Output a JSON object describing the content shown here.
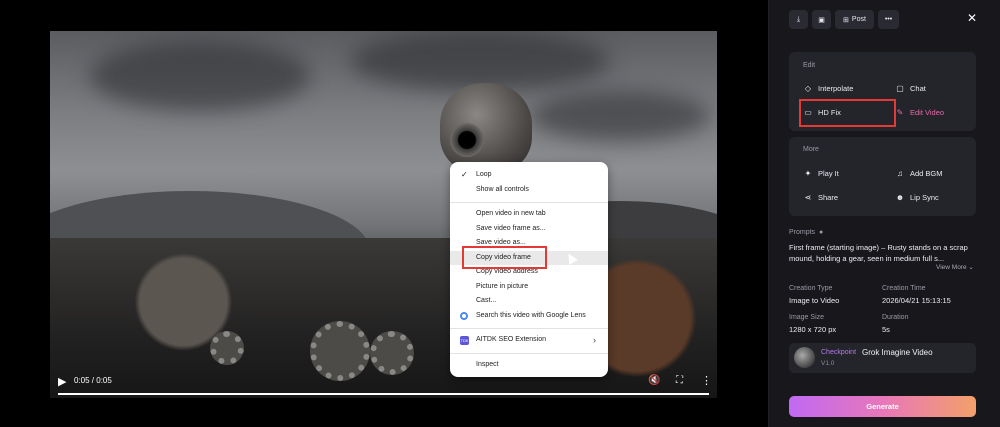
{
  "video": {
    "time": "0:05 / 0:05",
    "progress": 1.0
  },
  "context_menu": {
    "items": [
      {
        "label": "Loop",
        "checked": true
      },
      {
        "label": "Show all controls"
      },
      {
        "label": "Open video in new tab"
      },
      {
        "label": "Save video frame as..."
      },
      {
        "label": "Save video as..."
      },
      {
        "label": "Copy video frame"
      },
      {
        "label": "Copy video address"
      },
      {
        "label": "Picture in picture"
      },
      {
        "label": "Cast..."
      },
      {
        "label": "Search this video with Google Lens"
      },
      {
        "label": "AITDK SEO Extension",
        "icon_text": "TDK"
      },
      {
        "label": "Inspect"
      }
    ]
  },
  "toolbar": {
    "post_label": "Post",
    "icons": [
      "download-icon",
      "save-icon",
      "post-icon",
      "more-icon",
      "close-icon"
    ]
  },
  "edit": {
    "title": "Edit",
    "interpolate": "Interpolate",
    "chat": "Chat",
    "hd_fix": "HD Fix",
    "edit_video": "Edit Video"
  },
  "more": {
    "title": "More",
    "play_it": "Play It",
    "add_bgm": "Add BGM",
    "share": "Share",
    "lip_sync": "Lip Sync"
  },
  "details": {
    "prompts_label": "Prompts",
    "prompt_text": "First frame (starting image) – Rusty stands on a scrap mound, holding a gear, seen in medium full s...",
    "view_more": "View More",
    "creation_type_label": "Creation Type",
    "creation_type": "Image to Video",
    "creation_time_label": "Creation Time",
    "creation_time": "2026/04/21 15:13:15",
    "image_size_label": "Image Size",
    "image_size": "1280 x 720 px",
    "duration_label": "Duration",
    "duration": "5s"
  },
  "model": {
    "badge": "Checkpoint",
    "name": "Grok Imagine Video",
    "version": "V1.0"
  },
  "generate_label": "Generate",
  "colors": {
    "accent_pink": "#e96aa6",
    "highlight_red": "#e53935",
    "panel_bg": "#17171c"
  }
}
